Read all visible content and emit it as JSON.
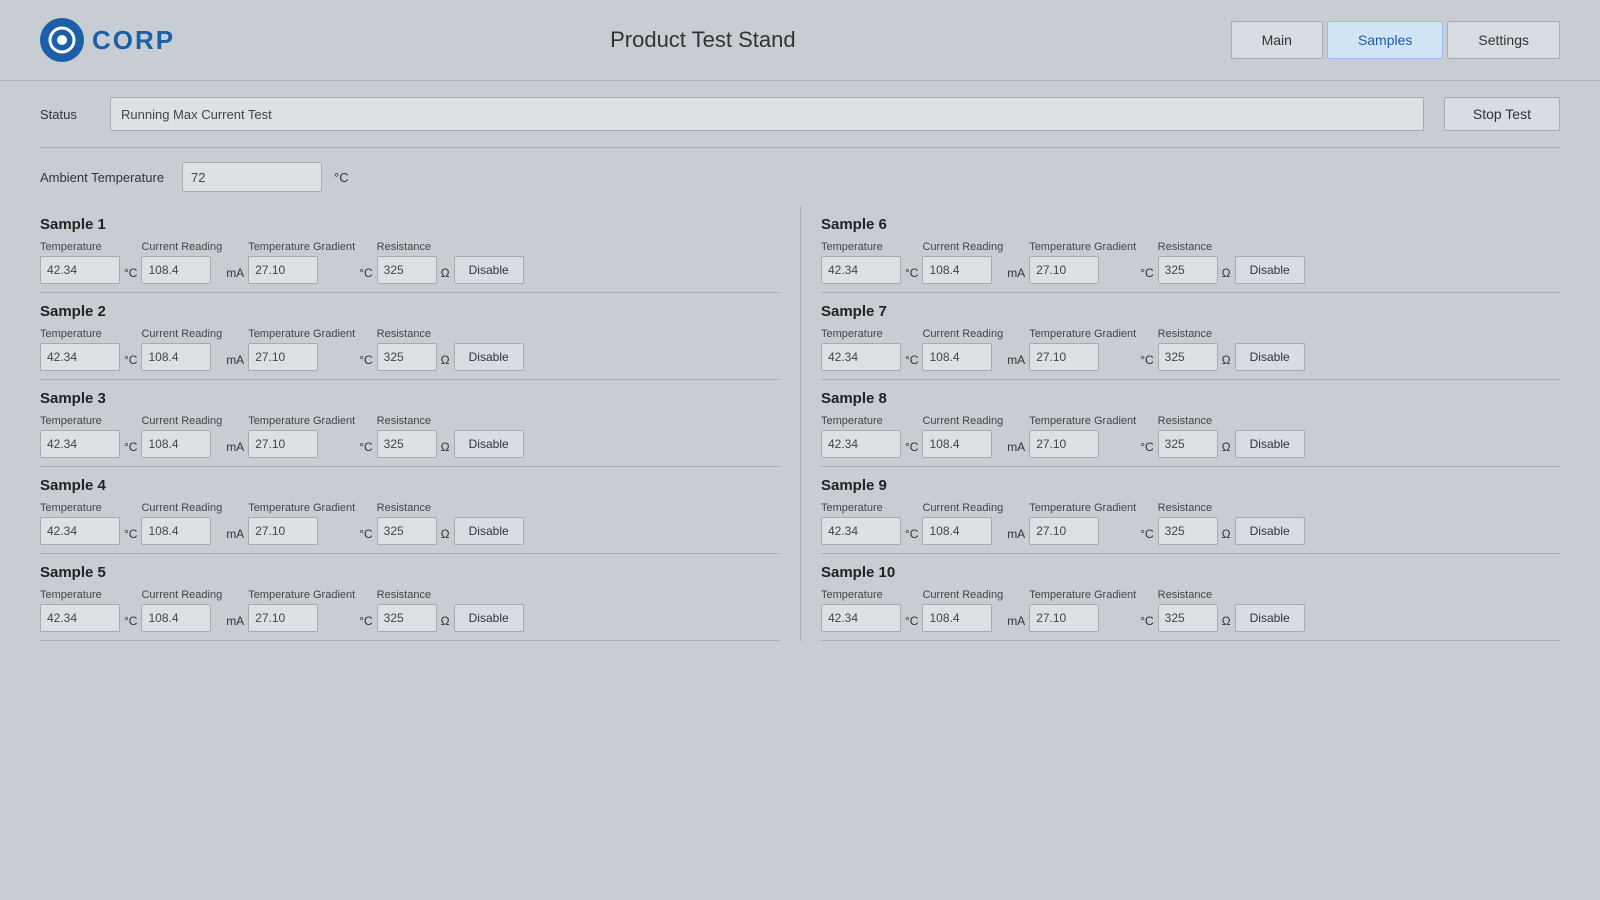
{
  "header": {
    "logo_letter": "C",
    "logo_text": "CORP",
    "title": "Product Test Stand",
    "nav": [
      {
        "label": "Main",
        "active": false
      },
      {
        "label": "Samples",
        "active": true
      },
      {
        "label": "Settings",
        "active": false
      }
    ]
  },
  "status": {
    "label": "Status",
    "value": "Running Max Current Test",
    "stop_btn": "Stop Test"
  },
  "ambient": {
    "label": "Ambient Temperature",
    "value": "72",
    "unit": "°C"
  },
  "samples": [
    {
      "title": "Sample 1",
      "temperature": "42.34",
      "current": "108.4",
      "temp_gradient": "27.10",
      "resistance": "325",
      "disable_label": "Disable"
    },
    {
      "title": "Sample 2",
      "temperature": "42.34",
      "current": "108.4",
      "temp_gradient": "27.10",
      "resistance": "325",
      "disable_label": "Disable"
    },
    {
      "title": "Sample 3",
      "temperature": "42.34",
      "current": "108.4",
      "temp_gradient": "27.10",
      "resistance": "325",
      "disable_label": "Disable"
    },
    {
      "title": "Sample 4",
      "temperature": "42.34",
      "current": "108.4",
      "temp_gradient": "27.10",
      "resistance": "325",
      "disable_label": "Disable"
    },
    {
      "title": "Sample 5",
      "temperature": "42.34",
      "current": "108.4",
      "temp_gradient": "27.10",
      "resistance": "325",
      "disable_label": "Disable"
    },
    {
      "title": "Sample 6",
      "temperature": "42.34",
      "current": "108.4",
      "temp_gradient": "27.10",
      "resistance": "325",
      "disable_label": "Disable"
    },
    {
      "title": "Sample 7",
      "temperature": "42.34",
      "current": "108.4",
      "temp_gradient": "27.10",
      "resistance": "325",
      "disable_label": "Disable"
    },
    {
      "title": "Sample 8",
      "temperature": "42.34",
      "current": "108.4",
      "temp_gradient": "27.10",
      "resistance": "325",
      "disable_label": "Disable"
    },
    {
      "title": "Sample 9",
      "temperature": "42.34",
      "current": "108.4",
      "temp_gradient": "27.10",
      "resistance": "325",
      "disable_label": "Disable"
    },
    {
      "title": "Sample 10",
      "temperature": "42.34",
      "current": "108.4",
      "temp_gradient": "27.10",
      "resistance": "325",
      "disable_label": "Disable"
    }
  ],
  "field_labels": {
    "temperature": "Temperature",
    "current": "Current Reading",
    "temp_gradient": "Temperature Gradient",
    "resistance": "Resistance",
    "temp_unit": "°C",
    "current_unit": "mA",
    "temp_grad_unit": "°C",
    "resistance_unit": "Ω"
  }
}
